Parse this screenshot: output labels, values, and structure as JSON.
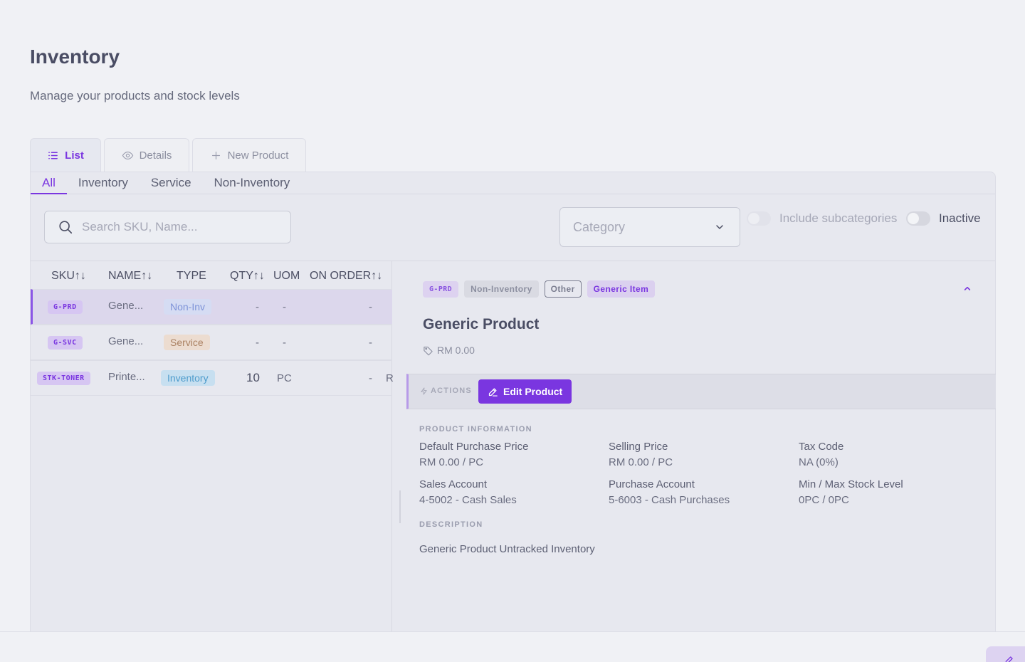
{
  "page": {
    "title": "Inventory",
    "subtitle": "Manage your products and stock levels"
  },
  "top_tabs": [
    {
      "label": "List",
      "icon": "list-icon",
      "active": true
    },
    {
      "label": "Details",
      "icon": "eye-icon",
      "active": false
    },
    {
      "label": "New Product",
      "icon": "plus-icon",
      "active": false
    }
  ],
  "sub_tabs": [
    {
      "label": "All",
      "active": true
    },
    {
      "label": "Inventory",
      "active": false
    },
    {
      "label": "Service",
      "active": false
    },
    {
      "label": "Non-Inventory",
      "active": false
    }
  ],
  "filters": {
    "search_placeholder": "Search SKU, Name...",
    "category_placeholder": "Category",
    "include_subcategories_label": "Include subcategories",
    "inactive_label": "Inactive"
  },
  "table": {
    "columns": [
      "SKU↑↓",
      "NAME↑↓",
      "TYPE",
      "QTY↑↓",
      "UOM",
      "ON ORDER↑↓"
    ],
    "rows": [
      {
        "sku": "G-PRD",
        "name": "Gene...",
        "type": "Non-Inv",
        "qty": "-",
        "uom": "-",
        "on_order": "-",
        "extra": "",
        "selected": true
      },
      {
        "sku": "G-SVC",
        "name": "Gene...",
        "type": "Service",
        "qty": "-",
        "uom": "-",
        "on_order": "-",
        "extra": "",
        "selected": false
      },
      {
        "sku": "STK-TONER",
        "name": "Printe...",
        "type": "Inventory",
        "qty": "10",
        "uom": "PC",
        "on_order": "-",
        "extra": "R",
        "selected": false
      }
    ]
  },
  "detail": {
    "tags": {
      "sku": "G-PRD",
      "type": "Non-Inventory",
      "category": "Other",
      "label": "Generic Item"
    },
    "title": "Generic Product",
    "price": "RM 0.00",
    "actions_label": "ACTIONS",
    "edit_button": "Edit Product",
    "product_info_heading": "PRODUCT INFORMATION",
    "info": {
      "default_purchase_price_label": "Default Purchase Price",
      "default_purchase_price": "RM 0.00 / PC",
      "selling_price_label": "Selling Price",
      "selling_price": "RM 0.00 / PC",
      "tax_code_label": "Tax Code",
      "tax_code": "NA (0%)",
      "sales_account_label": "Sales Account",
      "sales_account": "4-5002 - Cash Sales",
      "purchase_account_label": "Purchase Account",
      "purchase_account": "5-6003 - Cash Purchases",
      "stock_level_label": "Min / Max Stock Level",
      "stock_level": "0PC / 0PC"
    },
    "description_heading": "DESCRIPTION",
    "description": "Generic Product Untracked Inventory"
  },
  "colors": {
    "accent": "#7a36e0",
    "background": "#f0f1f5",
    "panel": "#e7e8ef"
  }
}
